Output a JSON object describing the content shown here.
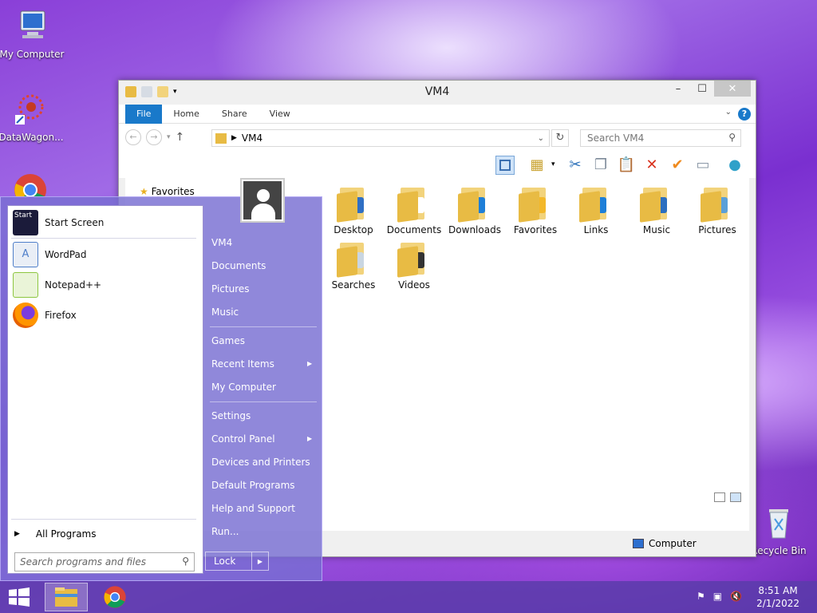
{
  "desktop": {
    "icons": [
      {
        "label": "My Computer",
        "icon": "computer-icon"
      },
      {
        "label": "DataWagon...",
        "icon": "datawagon-icon"
      },
      {
        "label": "Recycle Bin",
        "icon": "recycle-bin-icon"
      }
    ]
  },
  "explorer": {
    "title": "VM4",
    "tabs": [
      "File",
      "Home",
      "Share",
      "View"
    ],
    "address": {
      "path": "VM4"
    },
    "search": {
      "placeholder": "Search VM4"
    },
    "nav": {
      "favorites": "Favorites"
    },
    "folders": [
      {
        "label": "Desktop",
        "badge_color": "#2f6fc4"
      },
      {
        "label": "Documents",
        "badge_color": "#ffffff"
      },
      {
        "label": "Downloads",
        "badge_color": "#1e7fd8"
      },
      {
        "label": "Favorites",
        "badge_color": "#f3b82a"
      },
      {
        "label": "Links",
        "badge_color": "#1e7fd8"
      },
      {
        "label": "Music",
        "badge_color": "#2c6fc0"
      },
      {
        "label": "Pictures",
        "badge_color": "#5aa0d8"
      },
      {
        "label": "Searches",
        "badge_color": "#c9d6e2"
      },
      {
        "label": "Videos",
        "badge_color": "#333333"
      }
    ],
    "status": {
      "location": "Computer"
    }
  },
  "start_menu": {
    "pinned": [
      {
        "label": "Start Screen",
        "color": "#1b1b3a"
      },
      {
        "label": "WordPad",
        "color": "#4f7fc9"
      },
      {
        "label": "Notepad++",
        "color": "#8dc63f"
      },
      {
        "label": "Firefox",
        "color": "#e66000"
      }
    ],
    "all_programs": "All Programs",
    "search_placeholder": "Search programs and files",
    "right_links": [
      {
        "label": "VM4",
        "submenu": false
      },
      {
        "label": "Documents",
        "submenu": false
      },
      {
        "label": "Pictures",
        "submenu": false
      },
      {
        "label": "Music",
        "submenu": false
      },
      {
        "label": "Games",
        "submenu": false
      },
      {
        "label": "Recent Items",
        "submenu": true
      },
      {
        "label": "My Computer",
        "submenu": false
      },
      {
        "label": "Settings",
        "submenu": false
      },
      {
        "label": "Control Panel",
        "submenu": true
      },
      {
        "label": "Devices and Printers",
        "submenu": false
      },
      {
        "label": "Default Programs",
        "submenu": false
      },
      {
        "label": "Help and Support",
        "submenu": false
      },
      {
        "label": "Run...",
        "submenu": false
      }
    ],
    "lock_label": "Lock"
  },
  "taskbar": {
    "time": "8:51 AM",
    "date": "2/1/2022"
  }
}
